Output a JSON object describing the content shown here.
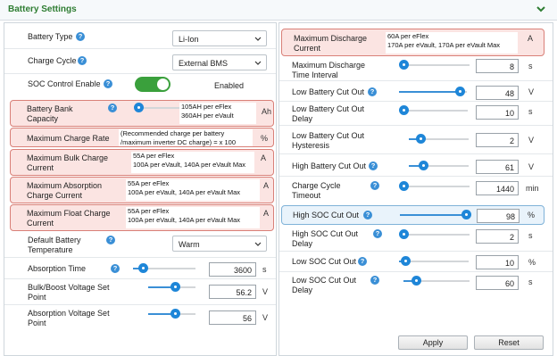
{
  "header": {
    "title": "Battery Settings"
  },
  "left": {
    "battery_type": {
      "label": "Battery Type",
      "value": "Li-Ion"
    },
    "charge_cycle": {
      "label": "Charge Cycle",
      "value": "External BMS"
    },
    "soc_control": {
      "label": "SOC Control Enable",
      "status": "Enabled",
      "on": true
    },
    "bank_capacity": {
      "label_1": "Battery Bank",
      "label_2": "Capacity",
      "note_1": "105AH per eFlex",
      "note_2": "360AH per eVault",
      "unit": "Ah",
      "slider": 0.0
    },
    "max_charge_rate": {
      "label": "Maximum Charge Rate",
      "note_1": "(Recommended charge per battery",
      "note_2": "/maximum inverter DC charge) = x 100",
      "unit": "%"
    },
    "max_bulk": {
      "label_1": "Maximum Bulk Charge",
      "label_2": "Current",
      "note_1": "55A per eFlex",
      "note_2": "100A per eVault, 140A per eVault Max",
      "unit": "A"
    },
    "max_absorption": {
      "label_1": "Maximum Absorption",
      "label_2": "Charge Current",
      "note_1": "55A per eFlex",
      "note_2": "100A per eVault, 140A per eVault Max",
      "unit": "A"
    },
    "max_float": {
      "label_1": "Maximum Float Charge",
      "label_2": "Current",
      "note_1": "55A per eFlex",
      "note_2": "100A per eVault, 140A per eVault Max",
      "unit": "A"
    },
    "default_temp": {
      "label_1": "Default Battery",
      "label_2": "Temperature",
      "value": "Warm"
    },
    "absorption_time": {
      "label": "Absorption Time",
      "value": "3600",
      "unit": "s",
      "slider": 0.16
    },
    "bulk_voltage": {
      "label_1": "Bulk/Boost Voltage Set",
      "label_2": "Point",
      "value": "56.2",
      "unit": "V",
      "slider": 0.58
    },
    "absorption_voltage": {
      "label_1": "Absorption Voltage Set",
      "label_2": "Point",
      "value": "56",
      "unit": "V",
      "slider": 0.58
    }
  },
  "right": {
    "max_discharge": {
      "label_1": "Maximum Discharge",
      "label_2": "Current",
      "note_1": "60A per eFlex",
      "note_2": "170A per eVault, 170A per eVault Max",
      "unit": "A"
    },
    "discharge_interval": {
      "label_1": "Maximum Discharge",
      "label_2": "Time Interval",
      "value": "8",
      "unit": "s",
      "slider": 0.0
    },
    "low_cutout": {
      "label": "Low Battery Cut Out",
      "value": "48",
      "unit": "V",
      "slider": 0.9
    },
    "low_cutout_delay": {
      "label_1": "Low Battery Cut Out",
      "label_2": "Delay",
      "value": "10",
      "unit": "s",
      "slider": 0.0
    },
    "low_cutout_hyst": {
      "label_1": "Low Battery Cut Out",
      "label_2": "Hysteresis",
      "value": "2",
      "unit": "V",
      "slider": 0.2
    },
    "high_cutout": {
      "label": "High Battery Cut Out",
      "value": "61",
      "unit": "V",
      "slider": 0.25
    },
    "charge_timeout": {
      "label_1": "Charge Cycle",
      "label_2": "Timeout",
      "value": "1440",
      "unit": "min",
      "slider": 0.0
    },
    "high_soc": {
      "label": "High SOC Cut Out",
      "value": "98",
      "unit": "%",
      "slider": 0.98
    },
    "high_soc_delay": {
      "label_1": "High SOC Cut Out",
      "label_2": "Delay",
      "value": "2",
      "unit": "s",
      "slider": 0.0
    },
    "low_soc": {
      "label": "Low SOC Cut Out",
      "value": "10",
      "unit": "%",
      "slider": 0.1
    },
    "low_soc_delay": {
      "label_1": "Low SOC Cut Out",
      "label_2": "Delay",
      "value": "60",
      "unit": "s",
      "slider": 0.2
    }
  },
  "buttons": {
    "apply": "Apply",
    "reset": "Reset"
  },
  "help_glyph": "?",
  "colors": {
    "accent": "#1e86d8",
    "toggle_on": "#3aa03c",
    "highlight": "#d98078",
    "header_title": "#2e7d32"
  }
}
